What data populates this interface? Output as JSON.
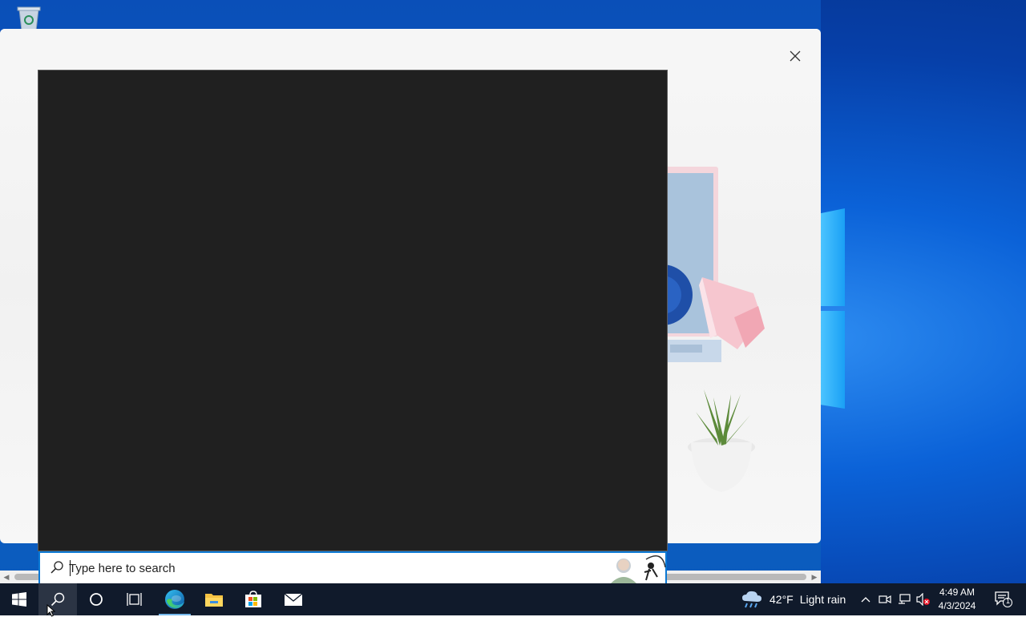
{
  "search": {
    "placeholder": "Type here to search",
    "value": ""
  },
  "taskbar": {
    "items": [
      {
        "name": "start",
        "icon": "windows-start-icon"
      },
      {
        "name": "search",
        "icon": "search-icon",
        "active": true
      },
      {
        "name": "cortana",
        "icon": "cortana-icon"
      },
      {
        "name": "task-view",
        "icon": "task-view-icon"
      },
      {
        "name": "edge",
        "icon": "edge-icon",
        "running": true
      },
      {
        "name": "file-explorer",
        "icon": "folder-icon"
      },
      {
        "name": "store",
        "icon": "store-icon"
      },
      {
        "name": "mail",
        "icon": "mail-icon"
      }
    ],
    "weather": {
      "temperature": "42°F",
      "condition": "Light rain",
      "icon": "rain-cloud-icon"
    },
    "clock": {
      "time": "4:49 AM",
      "date": "4/3/2024"
    },
    "notifications": {
      "count": "1"
    }
  },
  "colors": {
    "accent": "#0a78d4",
    "taskbar": "#101a2b",
    "search_panel": "#202020"
  }
}
